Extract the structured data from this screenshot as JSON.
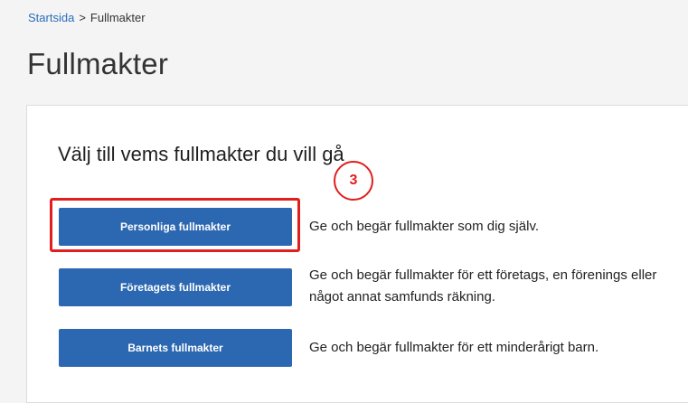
{
  "breadcrumb": {
    "home": "Startsida",
    "separator": ">",
    "current": "Fullmakter"
  },
  "page": {
    "title": "Fullmakter"
  },
  "card": {
    "heading": "Välj till vems fullmakter du vill gå",
    "options": [
      {
        "button": "Personliga fullmakter",
        "description": "Ge och begär fullmakter som dig själv."
      },
      {
        "button": "Företagets fullmakter",
        "description": "Ge och begär fullmakter för ett företags, en förenings eller något annat samfunds räkning."
      },
      {
        "button": "Barnets fullmakter",
        "description": "Ge och begär fullmakter för ett minderårigt barn."
      }
    ]
  },
  "annotation": {
    "step": "3",
    "color": "#e01e1e"
  },
  "colors": {
    "button_bg": "#2c67b1",
    "link": "#2a6ebb"
  }
}
